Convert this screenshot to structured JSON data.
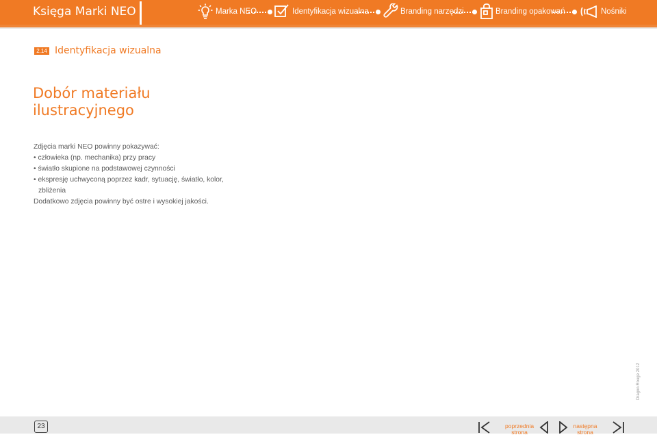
{
  "header": {
    "title": "Księga Marki NEO",
    "nav": [
      {
        "label": "Marka NEO",
        "icon": "lightbulb-icon"
      },
      {
        "label": "Identyfikacja wizualna",
        "icon": "checkbox-pencil-icon"
      },
      {
        "label": "Branding narzędzi",
        "icon": "wrench-icon"
      },
      {
        "label": "Branding opakowań",
        "icon": "shopping-bag-icon"
      },
      {
        "label": "Nośniki",
        "icon": "megaphone-icon"
      }
    ]
  },
  "section": {
    "number": "2.14",
    "title": "Identyfikacja wizualna"
  },
  "heading": {
    "line1": "Dobór materiału",
    "line2": "ilustracyjnego"
  },
  "body": {
    "intro": "Zdjęcia marki NEO powinny pokazywać:",
    "bullets": [
      "• człowieka (np. mechanika) przy pracy",
      "• światło skupione na podstawowej czynności",
      "• ekspresję uchwyconą poprzez kadr, sytuację, światło, kolor,"
    ],
    "bullet3_cont": "zbliżenia",
    "outro": "Dodatkowo zdjęcia powinny być ostre i wysokiej jakości."
  },
  "vertical_credit": "Dragon Rouge 2012",
  "footer": {
    "page": "23",
    "prev_label_1": "poprzednia",
    "prev_label_2": "strona",
    "next_label_1": "następna",
    "next_label_2": "strona"
  },
  "colors": {
    "accent": "#f07a24",
    "text": "#5a5a5a",
    "footer_bg": "#e9e9e9"
  }
}
